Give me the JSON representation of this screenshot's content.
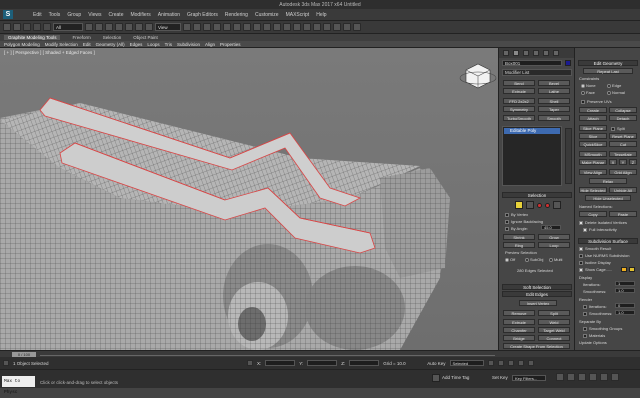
{
  "app": {
    "title": "Autodesk 3ds Max 2017  x64     Untitled",
    "accent": "#1d5f7a"
  },
  "menu": [
    "Edit",
    "Tools",
    "Group",
    "Views",
    "Create",
    "Modifiers",
    "Animation",
    "Graph Editors",
    "Rendering",
    "Customize",
    "MAXScript",
    "Help"
  ],
  "toolbar": {
    "selection_dropdown": "All",
    "view_dropdown": "View"
  },
  "ribbon_tabs": [
    "Graphite Modeling Tools",
    "Freeform",
    "Selection",
    "Object Paint"
  ],
  "ribbon_items": [
    "Polygon Modeling",
    "Modify Selection",
    "Edit",
    "Geometry (All)",
    "Edges",
    "Loops",
    "Tris",
    "Subdivision",
    "Align",
    "Properties"
  ],
  "viewport": {
    "label": "[ + ] [ Perspective ] [ Shaded + Edged Faces ]"
  },
  "command_panel": {
    "object_name": "Box001",
    "object_color": "#1b1b8f",
    "modifier_list": "Modifier List",
    "modifier_buttons": [
      "Bend",
      "Bevel",
      "Extrude",
      "Lathe",
      "FFD 2x2x2",
      "Shell",
      "Symmetry",
      "Taper",
      "TurboSmooth",
      "Smooth"
    ],
    "stack_item": "Editable Poly",
    "selection": {
      "header": "Selection",
      "by_vertex": "By Vertex",
      "ignore_backfacing": "Ignore Backfacing",
      "by_angle": "By Angle:",
      "by_angle_value": "45.0",
      "shrink": "Shrink",
      "grow": "Grow",
      "ring": "Ring",
      "loop": "Loop",
      "preview_selection": "Preview Selection",
      "preview_off": "Off",
      "preview_subobj": "SubObj",
      "preview_multi": "Multi",
      "status": "280 Edges Selected"
    },
    "soft_selection": "Soft Selection",
    "edit_edges": {
      "header": "Edit Edges",
      "insert_vertex": "Insert Vertex",
      "remove": "Remove",
      "split": "Split",
      "extrude": "Extrude",
      "weld": "Weld",
      "chamfer": "Chamfer",
      "target_weld": "Target Weld",
      "bridge": "Bridge",
      "connect": "Connect",
      "create_shape": "Create Shape From Selection",
      "weight": "Weight:",
      "weight_value": "1.0",
      "crease": "Crease:",
      "crease_value": "0.0"
    }
  },
  "right_panel": {
    "edit_geometry": "Edit Geometry",
    "repeat_last": "Repeat Last",
    "constraints": "Constraints",
    "c_none": "None",
    "c_edge": "Edge",
    "c_face": "Face",
    "c_normal": "Normal",
    "preserve_uvs": "Preserve UVs",
    "create": "Create",
    "collapse": "Collapse",
    "attach": "Attach",
    "detach": "Detach",
    "slice_plane": "Slice Plane",
    "split": "Split",
    "slice": "Slice",
    "reset_plane": "Reset Plane",
    "quickslice": "QuickSlice",
    "cut": "Cut",
    "msmooth": "MSmooth",
    "tessellate": "Tessellate",
    "make_planar": "Make Planar",
    "x": "X",
    "y": "Y",
    "z": "Z",
    "view_align": "View Align",
    "grid_align": "Grid Align",
    "relax": "Relax",
    "hide_selected": "Hide Selected",
    "unhide_all": "Unhide All",
    "hide_unselected": "Hide Unselected",
    "named_selections": "Named Selections:",
    "copy": "Copy",
    "paste": "Paste",
    "delete_isolated": "Delete Isolated Vertices",
    "full_interactivity": "Full Interactivity",
    "subdivision_surface": "Subdivision Surface",
    "smooth_result": "Smooth Result",
    "use_nurms": "Use NURMS Subdivision",
    "isoline_display": "Isoline Display",
    "show_cage": "Show Cage......",
    "display": "Display",
    "iterations": "Iterations:",
    "iterations_value": "1",
    "smoothness": "Smoothness:",
    "smoothness_value": "1.0",
    "render": "Render",
    "r_iterations_value": "0",
    "r_smoothness_value": "1.0",
    "separate_by": "Separate By",
    "smoothing_groups": "Smoothing Groups",
    "materials": "Materials",
    "update_options": "Update Options",
    "always": "Always",
    "when_rendering": "When Rendering",
    "manually": "Manually",
    "cage_color_1": "#f0b020",
    "cage_color_2": "#e0c030"
  },
  "timeline": {
    "thumb": "0 / 100"
  },
  "status": {
    "object_selected": "1 Object Selected",
    "x_label": "X:",
    "x_value": "",
    "y_label": "Y:",
    "y_value": "",
    "z_label": "Z:",
    "z_value": "",
    "grid": "Grid = 10.0",
    "auto_key": "Auto Key",
    "selected": "Selected",
    "set_key": "Set Key",
    "key_filters": "Key Filters...",
    "add_time_tag": "Add Time Tag",
    "script": "Max to Physc",
    "hint": "Click or click-and-drag to select objects"
  }
}
